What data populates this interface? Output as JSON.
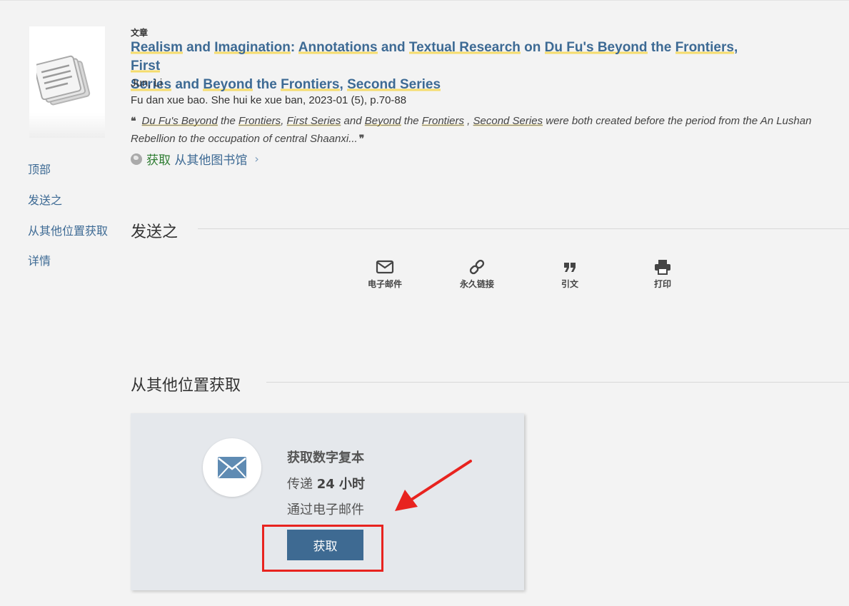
{
  "record": {
    "type_label": "文章",
    "title_parts": {
      "p1": "Realism",
      "p2": " and ",
      "p3": "Imagination",
      "p4": ": ",
      "p5": "Annotations",
      "p6": " and ",
      "p7": "Textual Research",
      "p8": " on ",
      "p9": "Du Fu's Beyond",
      "p10": " the ",
      "p11": "Frontiers",
      "p12": ", ",
      "p13": "First",
      "p14": "Series",
      "p15": " and ",
      "p16": "Beyond",
      "p17": " the ",
      "p18": "Frontiers",
      "p19": ", ",
      "p20": "Second Series"
    },
    "author": "Jun, Li",
    "source": "Fu dan xue bao. She hui ke xue ban, 2023-01 (5), p.70-88",
    "snippet": {
      "open_quote": "❝",
      "s1": "Du Fu's Beyond",
      "s2": " the ",
      "s3": "Frontiers",
      "s4": ", ",
      "s5": "First Series",
      "s6": " and ",
      "s7": "Beyond",
      "s8": " the ",
      "s9": "Frontiers",
      "s10": " , ",
      "s11": "Second Series",
      "s12": " were both created before the period from the An Lushan",
      "line2": "Rebellion to the occupation of central Shaanxi...",
      "close_quote": "❞"
    },
    "getit": {
      "get": "获取",
      "from_other": " 从其他图书馆",
      "chevron": "›"
    }
  },
  "nav": {
    "top": "顶部",
    "send_to": "发送之",
    "get_elsewhere": "从其他位置获取",
    "details": "详情"
  },
  "send_to_section": {
    "title": "发送之",
    "actions": [
      {
        "label": "电子邮件",
        "icon": "envelope-icon"
      },
      {
        "label": "永久链接",
        "icon": "link-icon"
      },
      {
        "label": "引文",
        "icon": "quote-icon"
      },
      {
        "label": "打印",
        "icon": "printer-icon"
      }
    ]
  },
  "get_section": {
    "title": "从其他位置获取",
    "card": {
      "title": "获取数字复本",
      "delivery_prefix": "传递 ",
      "delivery_time": "24 小时",
      "via": "通过电子邮件",
      "button": "获取",
      "icon": "envelope-icon"
    }
  },
  "colors": {
    "link": "#3d6a94",
    "highlight": "#f5dc6c",
    "button": "#3e6a92",
    "annotation_red": "#e8231f",
    "green": "#2e7d32"
  }
}
